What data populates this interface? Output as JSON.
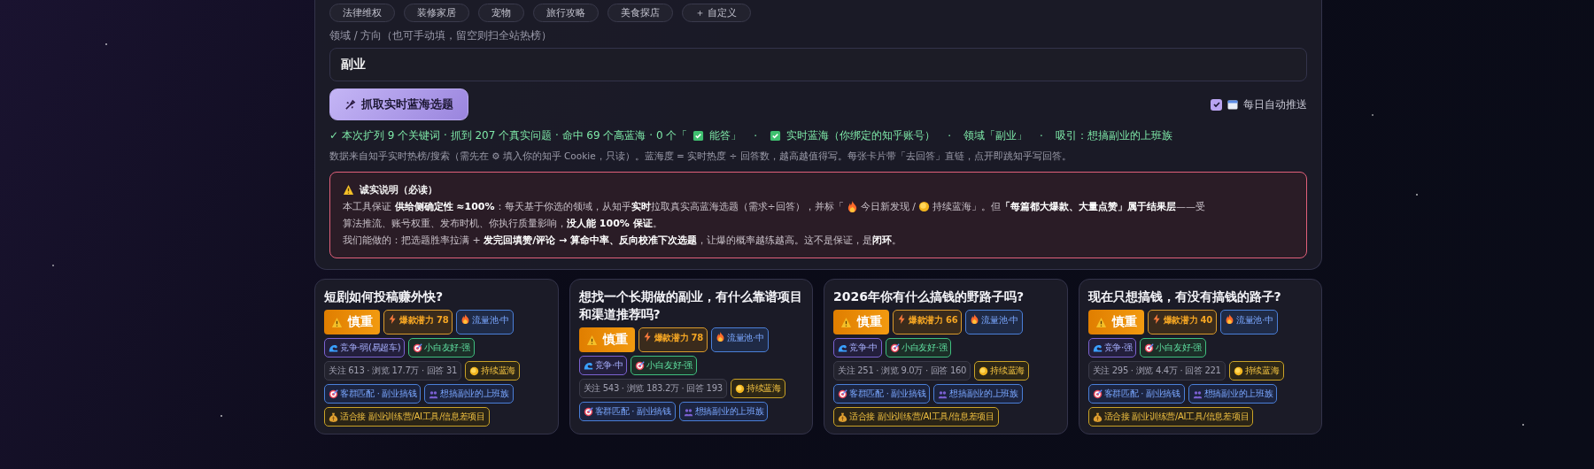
{
  "domain_chips": [
    {
      "label": "法律维权"
    },
    {
      "label": "装修家居"
    },
    {
      "label": "宠物"
    },
    {
      "label": "旅行攻略"
    },
    {
      "label": "美食探店"
    },
    {
      "label": "＋ 自定义"
    }
  ],
  "domain_field": {
    "label": "领域 / 方向（也可手动填，留空则扫全站热榜）",
    "value": "副业"
  },
  "fetch_button": {
    "label": "抓取实时蓝海选题"
  },
  "auto_push": {
    "label": "每日自动推送",
    "checked": true
  },
  "status_line": [
    {
      "kind": "text",
      "text": "✓ 本次扩列 9 个关键词 · 抓到 207 个真实问题 · 命中 69 个高蓝海 · 0 个「"
    },
    {
      "kind": "check"
    },
    {
      "kind": "text",
      "text": "能答」"
    },
    {
      "kind": "sep",
      "text": "·"
    },
    {
      "kind": "check"
    },
    {
      "kind": "text",
      "text": "实时蓝海（你绑定的知乎账号）"
    },
    {
      "kind": "sep",
      "text": "·"
    },
    {
      "kind": "text",
      "text": "领域「副业」"
    },
    {
      "kind": "sep",
      "text": "·"
    },
    {
      "kind": "text",
      "text": "吸引：想搞副业的上班族"
    }
  ],
  "info_line": "数据来自知乎实时热榜/搜索（需先在 ⚙ 填入你的知乎 Cookie，只读）。蓝海度 = 实时热度 ÷ 回答数，越高越值得写。每张卡片带「去回答」直链，点开即跳知乎写回答。",
  "notice": {
    "title": "诚实说明（必读）",
    "paragraph_1": [
      [
        {
          "kind": "text",
          "text": "本工具保证 **供给侧确定性 ≈100%**：每天基于你选的领域，从知乎**实时**拉取真实高蓝海选题（需求÷回答），并标「"
        },
        {
          "kind": "flame"
        },
        {
          "kind": "text",
          "text": "今日新发现 /"
        },
        {
          "kind": "coin"
        },
        {
          "kind": "text",
          "text": "持续蓝海」。但**「每篇都大爆款、大量点赞」属于结果层**——受"
        }
      ],
      [
        {
          "kind": "text",
          "text": "算法推流、账号权重、发布时机、你执行质量影响，**没人能 100% 保证**。"
        }
      ]
    ],
    "paragraph_2": "我们能做的：把选题胜率拉满 + **发完回填赞/评论 → 算命中率、反向校准下次选题**，让爆的概率越练越高。这不是保证，是**闭环**。"
  },
  "cards": [
    {
      "title": "短剧如何投稿赚外快?",
      "verdict": {
        "kind": "caution",
        "label": "慎重"
      },
      "tags": [
        {
          "kind": "potential",
          "text": "爆款潜力 78"
        },
        {
          "kind": "pool",
          "text": "流量池·中"
        },
        {
          "kind": "competition",
          "text": "竞争·弱(易超车)"
        },
        {
          "kind": "beginner",
          "text": "小白友好·强"
        },
        {
          "kind": "stats",
          "text": "关注 613 · 浏览 17.7万 · 回答 31"
        },
        {
          "kind": "status",
          "text": "持续蓝海"
        },
        {
          "kind": "match",
          "text": "客群匹配 · 副业搞钱"
        },
        {
          "kind": "audience",
          "text": "想搞副业的上班族"
        },
        {
          "kind": "fit",
          "text": "适合接 副业训练营/AI工具/信息差项目"
        }
      ]
    },
    {
      "title": "想找一个长期做的副业，有什么靠谱项目和渠道推荐吗?",
      "verdict": {
        "kind": "caution",
        "label": "慎重"
      },
      "tags": [
        {
          "kind": "potential",
          "text": "爆款潜力 78"
        },
        {
          "kind": "pool",
          "text": "流量池·中"
        },
        {
          "kind": "competition",
          "text": "竞争·中"
        },
        {
          "kind": "beginner",
          "text": "小白友好·强"
        },
        {
          "kind": "stats",
          "text": "关注 543 · 浏览 183.2万 · 回答 193"
        },
        {
          "kind": "status",
          "text": "持续蓝海"
        },
        {
          "kind": "match",
          "text": "客群匹配 · 副业搞钱"
        },
        {
          "kind": "audience",
          "text": "想搞副业的上班族"
        }
      ]
    },
    {
      "title": "2026年你有什么搞钱的野路子吗?",
      "verdict": {
        "kind": "caution",
        "label": "慎重"
      },
      "tags": [
        {
          "kind": "potential",
          "text": "爆款潜力 66"
        },
        {
          "kind": "pool",
          "text": "流量池·中"
        },
        {
          "kind": "competition",
          "text": "竞争·中"
        },
        {
          "kind": "beginner",
          "text": "小白友好·强"
        },
        {
          "kind": "stats",
          "text": "关注 251 · 浏览 9.0万 · 回答 160"
        },
        {
          "kind": "status",
          "text": "持续蓝海"
        },
        {
          "kind": "match",
          "text": "客群匹配 · 副业搞钱"
        },
        {
          "kind": "audience",
          "text": "想搞副业的上班族"
        },
        {
          "kind": "fit",
          "text": "适合接 副业训练营/AI工具/信息差项目"
        }
      ]
    },
    {
      "title": "现在只想搞钱，有没有搞钱的路子?",
      "verdict": {
        "kind": "caution",
        "label": "慎重"
      },
      "tags": [
        {
          "kind": "potential",
          "text": "爆款潜力 40"
        },
        {
          "kind": "pool",
          "text": "流量池·中"
        },
        {
          "kind": "competition",
          "text": "竞争·强"
        },
        {
          "kind": "beginner",
          "text": "小白友好·强"
        },
        {
          "kind": "stats",
          "text": "关注 295 · 浏览 4.4万 · 回答 221"
        },
        {
          "kind": "status",
          "text": "持续蓝海"
        },
        {
          "kind": "match",
          "text": "客群匹配 · 副业搞钱"
        },
        {
          "kind": "audience",
          "text": "想搞副业的上班族"
        },
        {
          "kind": "fit",
          "text": "适合接 副业训练营/AI工具/信息差项目"
        }
      ]
    }
  ]
}
